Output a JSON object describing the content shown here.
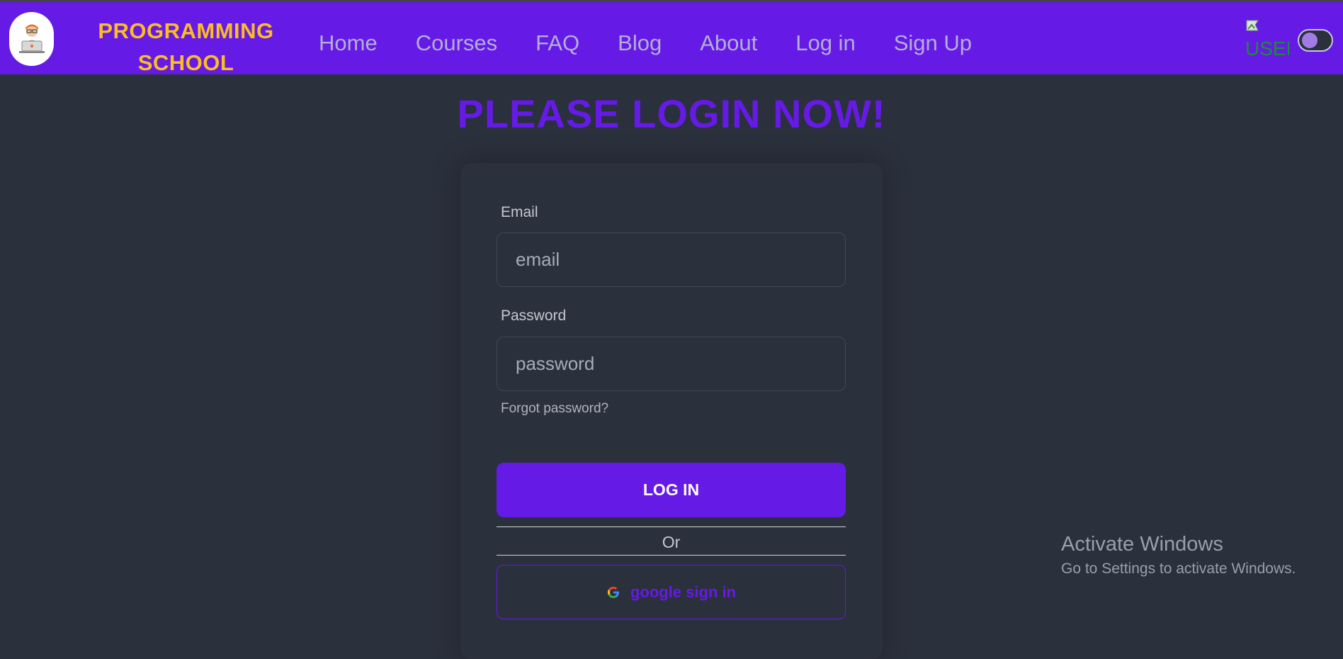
{
  "navbar": {
    "brand_line1": "PROGRAMMING",
    "brand_line2": "SCHOOL",
    "links": [
      "Home",
      "Courses",
      "FAQ",
      "Blog",
      "About",
      "Log in",
      "Sign Up"
    ],
    "user_image_alt": "USER",
    "theme_toggle": "off"
  },
  "main": {
    "title": "PLEASE LOGIN NOW!",
    "email_label": "Email",
    "email_placeholder": "email",
    "password_label": "Password",
    "password_placeholder": "password",
    "forgot_label": "Forgot password?",
    "login_label": "LOG IN",
    "or_label": "Or",
    "google_label": "google sign in"
  },
  "overlay": {
    "activate_title": "Activate Windows",
    "activate_sub": "Go to Settings to activate Windows."
  },
  "colors": {
    "primary": "#661ae6",
    "brand_text": "#fbbd23",
    "background": "#2a303c"
  }
}
